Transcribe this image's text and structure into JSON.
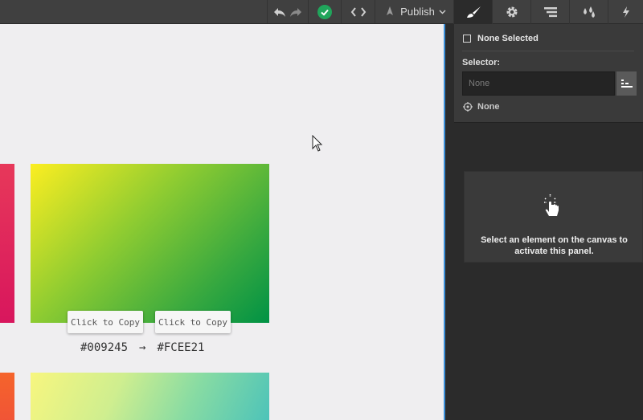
{
  "toolbar": {
    "undo_icon": "undo-icon",
    "redo_icon": "redo-icon",
    "status_icon": "check-circle-icon",
    "status_color": "#20a55b",
    "code_icon": "code-brackets-icon",
    "publish_label": "Publish",
    "tabs": [
      "brush-icon",
      "gear-icon",
      "navigator-icon",
      "drops-icon",
      "lightning-icon"
    ]
  },
  "canvas": {
    "copy_buttons": [
      "Click to Copy",
      "Click to Copy"
    ],
    "hex_from": "#009245",
    "arrow": "→",
    "hex_to": "#FCEE21",
    "gradient_colors": [
      "#FCEE21",
      "#009245"
    ]
  },
  "panel": {
    "selection_label": "None Selected",
    "selector_label": "Selector:",
    "selector_placeholder": "None",
    "target_label": "None",
    "hint_text": "Select an element on the canvas to activate this panel."
  }
}
